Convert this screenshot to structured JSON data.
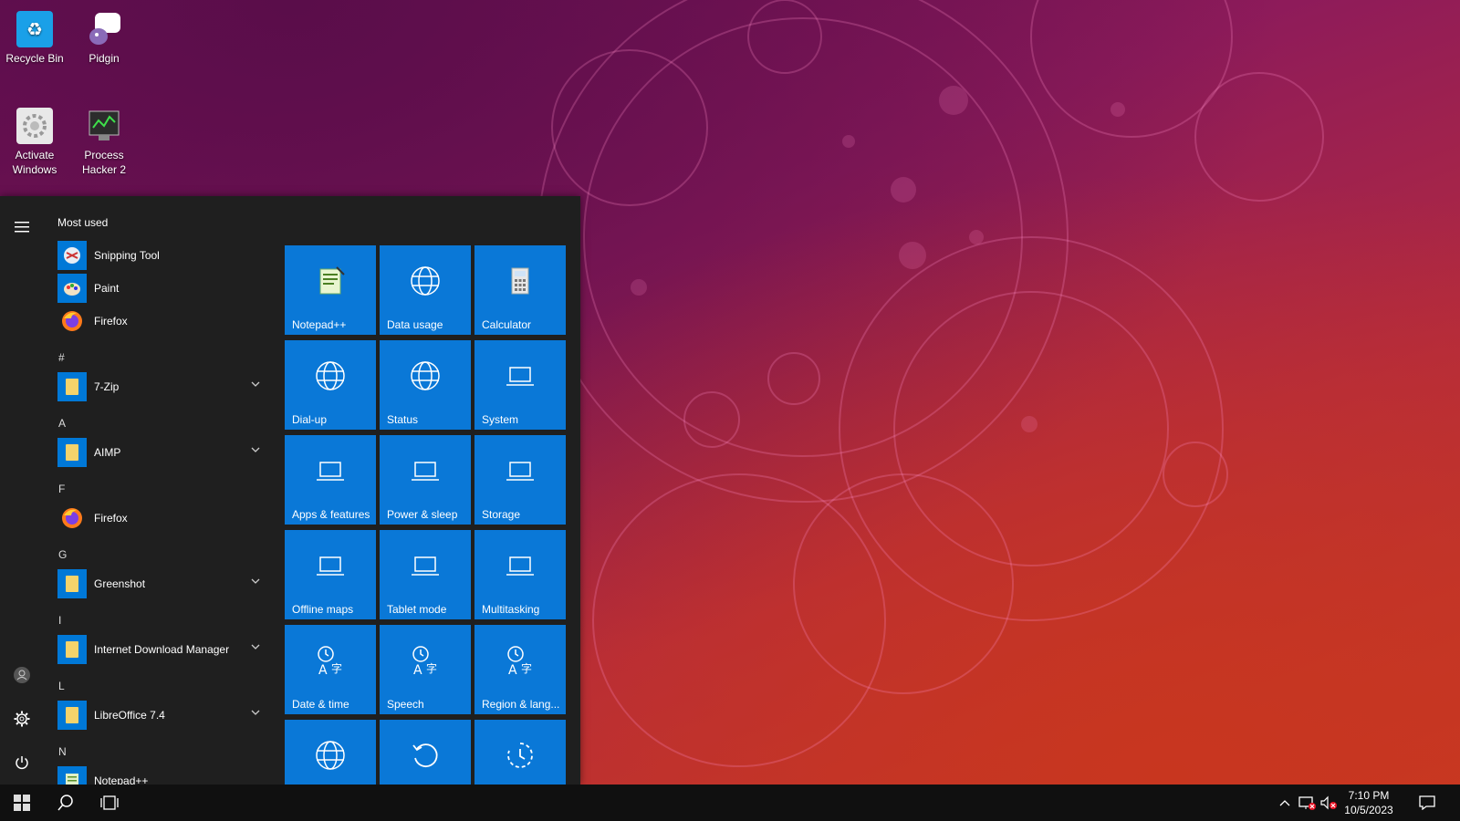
{
  "desktop": {
    "icons": [
      {
        "label": "Recycle Bin",
        "icon": "recycle-bin-icon"
      },
      {
        "label": "Pidgin",
        "icon": "pidgin-icon"
      },
      {
        "label": "Activate Windows",
        "icon": "activate-windows-icon"
      },
      {
        "label": "Process Hacker 2",
        "icon": "process-hacker-icon"
      }
    ]
  },
  "start_menu": {
    "rail": {
      "menu_icon": "hamburger-icon",
      "user_icon": "user-icon",
      "settings_icon": "gear-icon",
      "power_icon": "power-icon"
    },
    "list_heading": "Most used",
    "most_used": [
      {
        "label": "Snipping Tool",
        "icon": "snipping-tool-icon"
      },
      {
        "label": "Paint",
        "icon": "paint-icon"
      },
      {
        "label": "Firefox",
        "icon": "firefox-icon"
      }
    ],
    "groups": [
      {
        "letter": "#",
        "apps": [
          {
            "label": "7-Zip",
            "expandable": true
          }
        ]
      },
      {
        "letter": "A",
        "apps": [
          {
            "label": "AIMP",
            "expandable": true
          }
        ]
      },
      {
        "letter": "F",
        "apps": [
          {
            "label": "Firefox",
            "expandable": false
          }
        ]
      },
      {
        "letter": "G",
        "apps": [
          {
            "label": "Greenshot",
            "expandable": true
          }
        ]
      },
      {
        "letter": "I",
        "apps": [
          {
            "label": "Internet Download Manager",
            "expandable": true
          }
        ]
      },
      {
        "letter": "L",
        "apps": [
          {
            "label": "LibreOffice 7.4",
            "expandable": true
          }
        ]
      },
      {
        "letter": "N",
        "apps": [
          {
            "label": "Notepad++",
            "expandable": false
          }
        ]
      }
    ],
    "tiles": [
      {
        "label": "Notepad++",
        "icon": "notepad-plus-plus-icon"
      },
      {
        "label": "Data usage",
        "icon": "globe-icon"
      },
      {
        "label": "Calculator",
        "icon": "calculator-icon"
      },
      {
        "label": "Dial-up",
        "icon": "globe-icon"
      },
      {
        "label": "Status",
        "icon": "globe-icon"
      },
      {
        "label": "System",
        "icon": "laptop-icon"
      },
      {
        "label": "Apps & features",
        "icon": "laptop-icon"
      },
      {
        "label": "Power & sleep",
        "icon": "laptop-icon"
      },
      {
        "label": "Storage",
        "icon": "laptop-icon"
      },
      {
        "label": "Offline maps",
        "icon": "laptop-icon"
      },
      {
        "label": "Tablet mode",
        "icon": "laptop-icon"
      },
      {
        "label": "Multitasking",
        "icon": "laptop-icon"
      },
      {
        "label": "Date & time",
        "icon": "time-language-icon"
      },
      {
        "label": "Speech",
        "icon": "time-language-icon"
      },
      {
        "label": "Region & lang...",
        "icon": "time-language-icon"
      },
      {
        "label": "",
        "icon": "globe-icon"
      },
      {
        "label": "",
        "icon": "refresh-icon"
      },
      {
        "label": "",
        "icon": "recovery-icon"
      }
    ]
  },
  "taskbar": {
    "start_icon": "windows-start-icon",
    "search_icon": "search-icon",
    "task_view_icon": "task-view-icon",
    "tray": {
      "chevron_icon": "chevron-up-icon",
      "network_icon": "network-disconnected-icon",
      "volume_icon": "volume-muted-icon",
      "notification_icon": "action-center-icon"
    },
    "time": "7:10 PM",
    "date": "10/5/2023"
  },
  "colors": {
    "tile": "#0a78d7",
    "start_bg": "#1f1f1f",
    "taskbar_bg": "#101010"
  }
}
